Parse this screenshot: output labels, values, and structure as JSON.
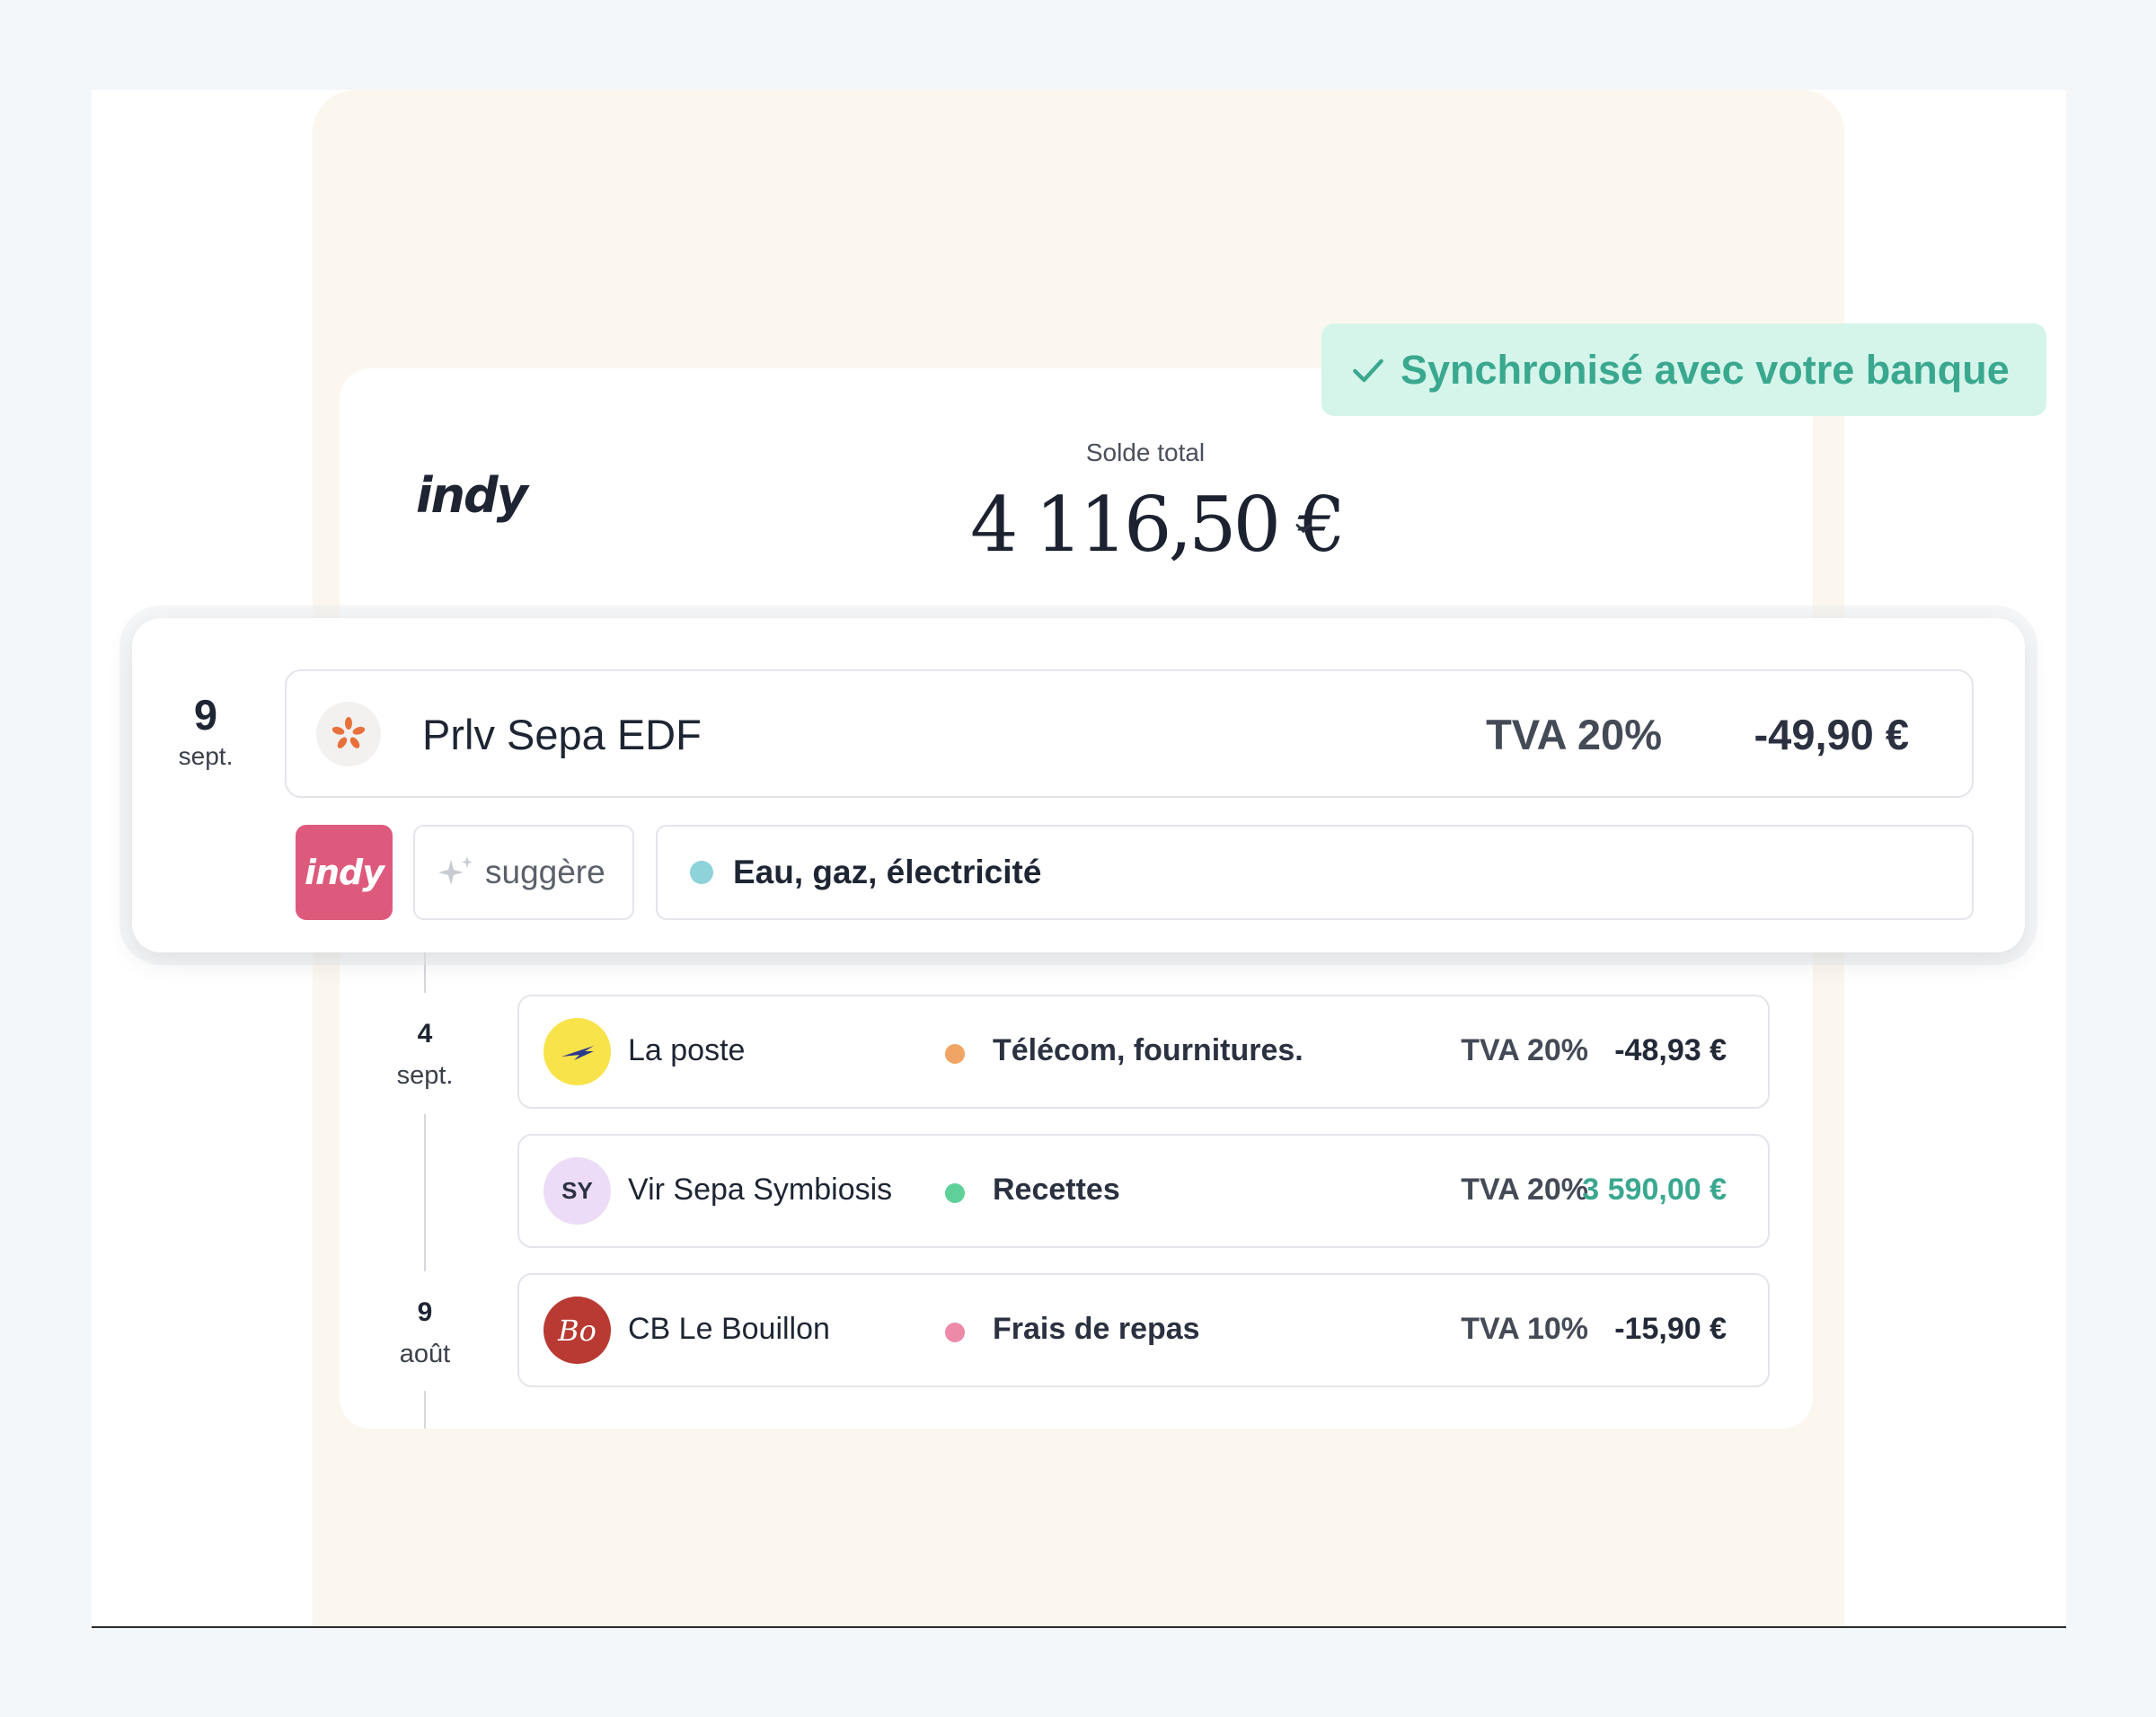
{
  "header": {
    "logo_text": "indy",
    "balance_label": "Solde total",
    "balance_value": "4 116,50 €"
  },
  "sync_badge": {
    "label": "Synchronisé avec votre banque"
  },
  "highlighted_transaction": {
    "day": "9",
    "month": "sept.",
    "name": "Prlv Sepa EDF",
    "tva": "TVA 20%",
    "amount": "-49,90 €",
    "ai_logo": "indy",
    "suggest_label": "suggère",
    "category": "Eau, gaz, électricité",
    "category_color": "#8dd3d9"
  },
  "transactions": [
    {
      "date_day": "4",
      "date_month": "sept.",
      "avatar_text": "",
      "name": "La poste",
      "category": "Télécom, fournitures.",
      "category_color": "#f0a565",
      "tva": "TVA 20%",
      "amount": "-48,93 €",
      "amount_color": "#232937"
    },
    {
      "date_day": "",
      "date_month": "",
      "avatar_text": "SY",
      "name": "Vir Sepa Symbiosis",
      "category": "Recettes",
      "category_color": "#5fd09a",
      "tva": "TVA 20%",
      "amount": "3 590,00 €",
      "amount_color": "#3aa88f"
    },
    {
      "date_day": "9",
      "date_month": "août",
      "avatar_text": "Bo",
      "name": "CB Le Bouillon",
      "category": "Frais de repas",
      "category_color": "#ec8aa7",
      "tva": "TVA 10%",
      "amount": "-15,90 €",
      "amount_color": "#232937"
    }
  ],
  "colors": {
    "accent_green": "#3aa88f",
    "brand_pink": "#de5a7c",
    "beige_bg": "#fbf7ee"
  }
}
